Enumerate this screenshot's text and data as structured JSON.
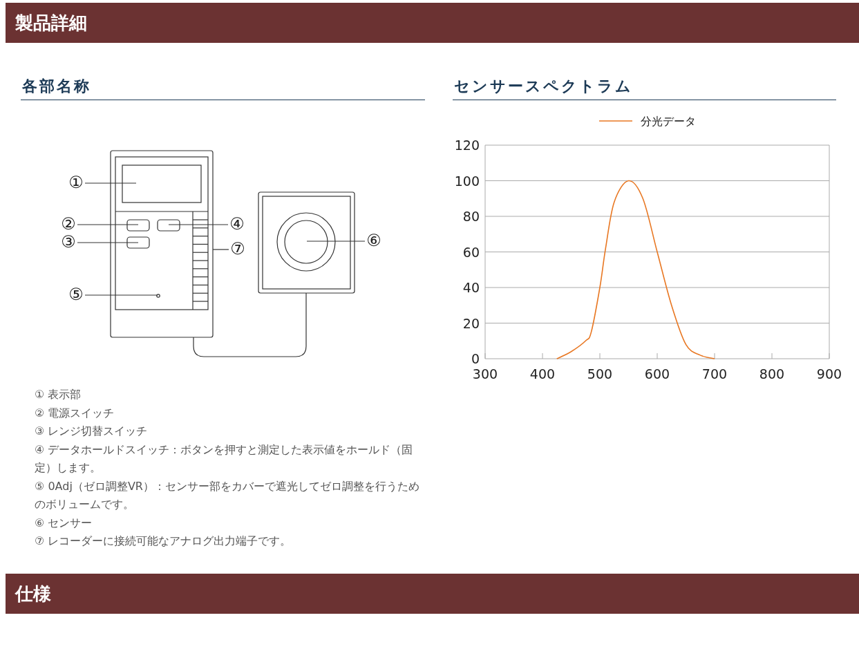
{
  "sections": [
    {
      "title": "製品詳細"
    },
    {
      "title": "仕様"
    }
  ],
  "parts": {
    "heading": "各部名称",
    "callouts": [
      "①",
      "②",
      "③",
      "④",
      "⑤",
      "⑥",
      "⑦"
    ],
    "descriptions": [
      "① 表示部",
      "② 電源スイッチ",
      "③ レンジ切替スイッチ",
      "④ データホールドスイッチ：ボタンを押すと測定した表示値をホールド（固定）します。",
      "⑤ 0Adj（ゼロ調整VR）：センサー部をカバーで遮光してゼロ調整を行うためのボリュームです。",
      "⑥ センサー",
      "⑦ レコーダーに接続可能なアナログ出力端子です。"
    ]
  },
  "spectrum": {
    "heading": "センサースペクトラム",
    "chart_data": {
      "type": "line",
      "x": [
        425,
        450,
        475,
        485,
        500,
        510,
        525,
        550,
        575,
        600,
        625,
        650,
        675,
        700
      ],
      "series": [
        {
          "name": "分光データ",
          "color": "#e87722",
          "values": [
            0,
            4,
            10,
            15,
            40,
            62,
            88,
            100,
            90,
            60,
            30,
            8,
            2,
            0
          ]
        }
      ],
      "xlim": [
        300,
        900
      ],
      "ylim": [
        0,
        120
      ],
      "xticks": [
        300,
        400,
        500,
        600,
        700,
        800,
        900
      ],
      "yticks": [
        0,
        20,
        40,
        60,
        80,
        100,
        120
      ],
      "grid": true
    }
  }
}
